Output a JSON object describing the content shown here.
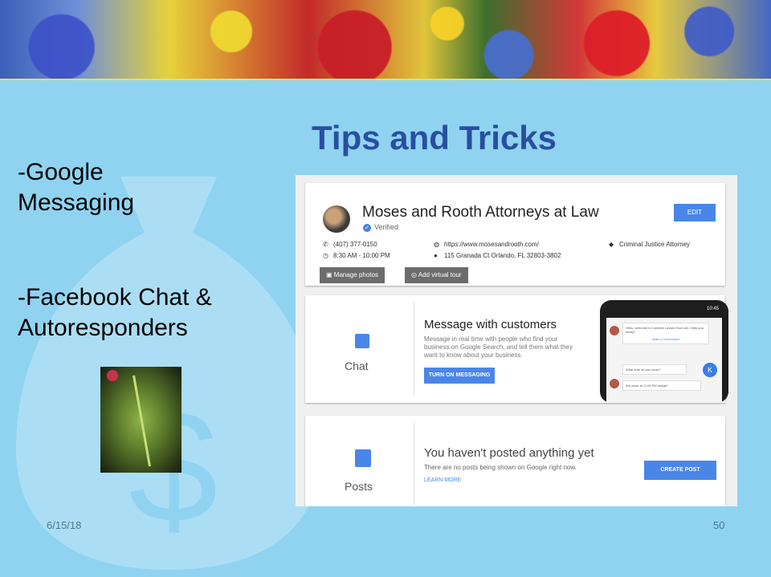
{
  "slide": {
    "title": "Tips and Tricks",
    "bullets": [
      "-Google",
      "Messaging",
      "-Facebook Chat &",
      "Autoresponders"
    ],
    "footer_date": "6/15/18",
    "page_number": "50"
  },
  "business_card": {
    "name": "Moses and Rooth Attorneys at Law",
    "verified": "Verified",
    "edit": "EDIT",
    "phone": "(407) 377-0150",
    "hours": "8:30 AM - 10:00 PM",
    "website": "https://www.mosesandrooth.com/",
    "address": "115 Granada Ct Orlando, FL 32803-3802",
    "category": "Criminal Justice Attorney",
    "manage_photos": "Manage photos",
    "add_virtual_tour": "Add virtual tour"
  },
  "chat_card": {
    "tile_label": "Chat",
    "title": "Message with customers",
    "description": "Message in real time with people who find your business on Google Search, and tell them what they want to know about your business.",
    "button": "TURN ON MESSAGING",
    "phone_time": "10:45",
    "bubble1": "Hello, welcome to Carmine Lavalo! How can I help you today?",
    "bubble_link": "Make a reservation",
    "bubble2": "What time do you close?",
    "bubble3": "We close at 11:00 PM tonight",
    "avatar_letter": "K"
  },
  "posts_card": {
    "tile_label": "Posts",
    "title": "You haven't posted anything yet",
    "description": "There are no posts being shown on Google right now.",
    "learn_more": "LEARN MORE",
    "button": "CREATE POST"
  },
  "colors": {
    "slide_bg": "#8fd3f1",
    "title": "#2a4ea0",
    "google_blue": "#4a86e8"
  }
}
